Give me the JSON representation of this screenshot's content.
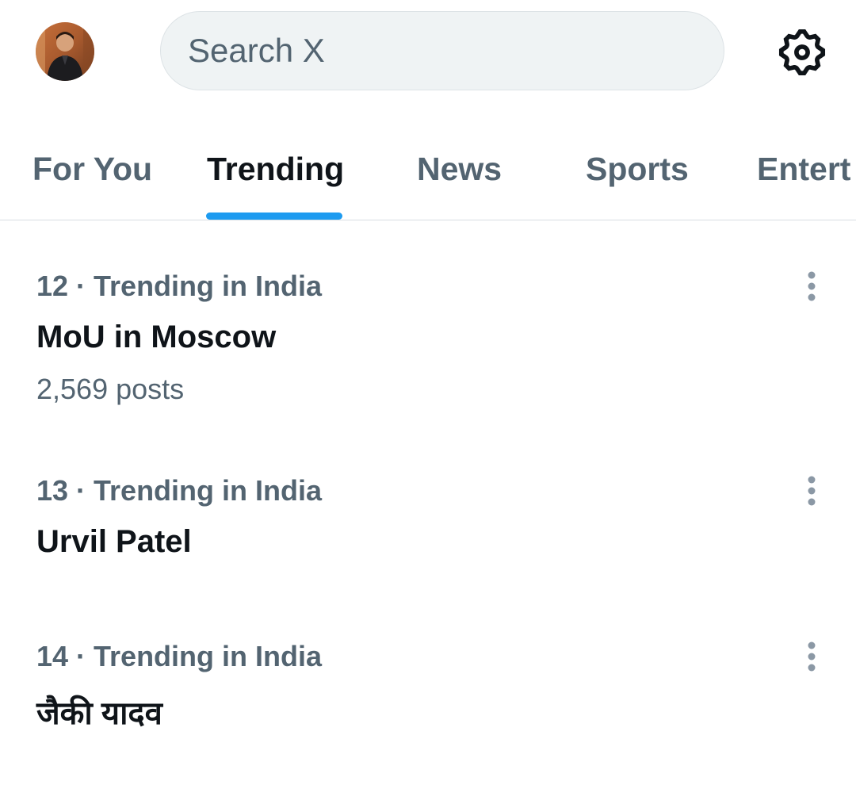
{
  "header": {
    "avatar_icon": "profile-avatar",
    "search": {
      "placeholder": "Search X",
      "value": ""
    },
    "settings_icon": "gear-icon"
  },
  "tabs": [
    {
      "label": "For You",
      "active": false
    },
    {
      "label": "Trending",
      "active": true
    },
    {
      "label": "News",
      "active": false
    },
    {
      "label": "Sports",
      "active": false
    },
    {
      "label": "Entert",
      "active": false
    }
  ],
  "trends": [
    {
      "meta": "12 · Trending in India",
      "title": "MoU in Moscow",
      "count": "2,569 posts",
      "more_icon": "more-vertical-icon"
    },
    {
      "meta": "13 · Trending in India",
      "title": "Urvil Patel",
      "more_icon": "more-vertical-icon"
    },
    {
      "meta": "14 · Trending in India",
      "title": "जैकी यादव",
      "more_icon": "more-vertical-icon"
    }
  ],
  "colors": {
    "accent": "#1d9bf0",
    "text_primary": "#0f1419",
    "text_secondary": "#536471",
    "search_bg": "#eff3f4"
  }
}
